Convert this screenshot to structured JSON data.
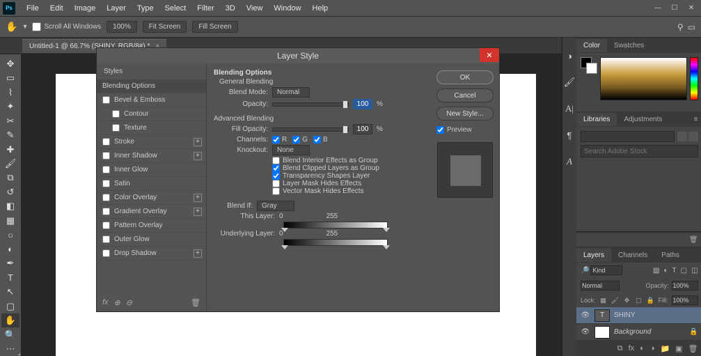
{
  "menubar": [
    "File",
    "Edit",
    "Image",
    "Layer",
    "Type",
    "Select",
    "Filter",
    "3D",
    "View",
    "Window",
    "Help"
  ],
  "optbar": {
    "scroll_all": "Scroll All Windows",
    "zoom": "100%",
    "fit": "Fit Screen",
    "fill": "Fill Screen"
  },
  "doc_tab": "Untitled-1 @ 66.7% (SHINY, RGB/8#) *",
  "dialog": {
    "title": "Layer Style",
    "styles_header": "Styles",
    "styles": [
      {
        "label": "Blending Options",
        "selected": true,
        "hasCheck": false
      },
      {
        "label": "Bevel & Emboss",
        "hasCheck": true
      },
      {
        "label": "Contour",
        "hasCheck": true,
        "indent": true
      },
      {
        "label": "Texture",
        "hasCheck": true,
        "indent": true
      },
      {
        "label": "Stroke",
        "hasCheck": true,
        "plus": true
      },
      {
        "label": "Inner Shadow",
        "hasCheck": true,
        "plus": true
      },
      {
        "label": "Inner Glow",
        "hasCheck": true
      },
      {
        "label": "Satin",
        "hasCheck": true
      },
      {
        "label": "Color Overlay",
        "hasCheck": true,
        "plus": true
      },
      {
        "label": "Gradient Overlay",
        "hasCheck": true,
        "plus": true
      },
      {
        "label": "Pattern Overlay",
        "hasCheck": true
      },
      {
        "label": "Outer Glow",
        "hasCheck": true
      },
      {
        "label": "Drop Shadow",
        "hasCheck": true,
        "plus": true
      }
    ],
    "blending_options_label": "Blending Options",
    "general_blending_label": "General Blending",
    "blend_mode_label": "Blend Mode:",
    "blend_mode_value": "Normal",
    "opacity_label": "Opacity:",
    "opacity_value": "100",
    "pct": "%",
    "advanced_label": "Advanced Blending",
    "fill_opacity_label": "Fill Opacity:",
    "fill_opacity_value": "100",
    "channels_label": "Channels:",
    "ch_r": "R",
    "ch_g": "G",
    "ch_b": "B",
    "knockout_label": "Knockout:",
    "knockout_value": "None",
    "cb_interior": "Blend Interior Effects as Group",
    "cb_clipped": "Blend Clipped Layers as Group",
    "cb_transp": "Transparency Shapes Layer",
    "cb_layermask": "Layer Mask Hides Effects",
    "cb_vectormask": "Vector Mask Hides Effects",
    "blendif_label": "Blend If:",
    "blendif_value": "Gray",
    "this_layer_label": "This Layer:",
    "this_lo": "0",
    "this_hi": "255",
    "under_label": "Underlying Layer:",
    "under_lo": "0",
    "under_hi": "255",
    "ok": "OK",
    "cancel": "Cancel",
    "new_style": "New Style...",
    "preview": "Preview"
  },
  "panels": {
    "color": "Color",
    "swatches": "Swatches",
    "libraries": "Libraries",
    "adjustments": "Adjustments",
    "lib_search_placeholder": "Search Adobe Stock",
    "layers": "Layers",
    "channels": "Channels",
    "paths": "Paths",
    "kind_placeholder": "Kind",
    "normal": "Normal",
    "opacity_lbl": "Opacity:",
    "opacity_val": "100%",
    "lock_lbl": "Lock:",
    "fill_lbl": "Fill:",
    "fill_val": "100%",
    "layer1": "SHINY",
    "layer2": "Background"
  }
}
